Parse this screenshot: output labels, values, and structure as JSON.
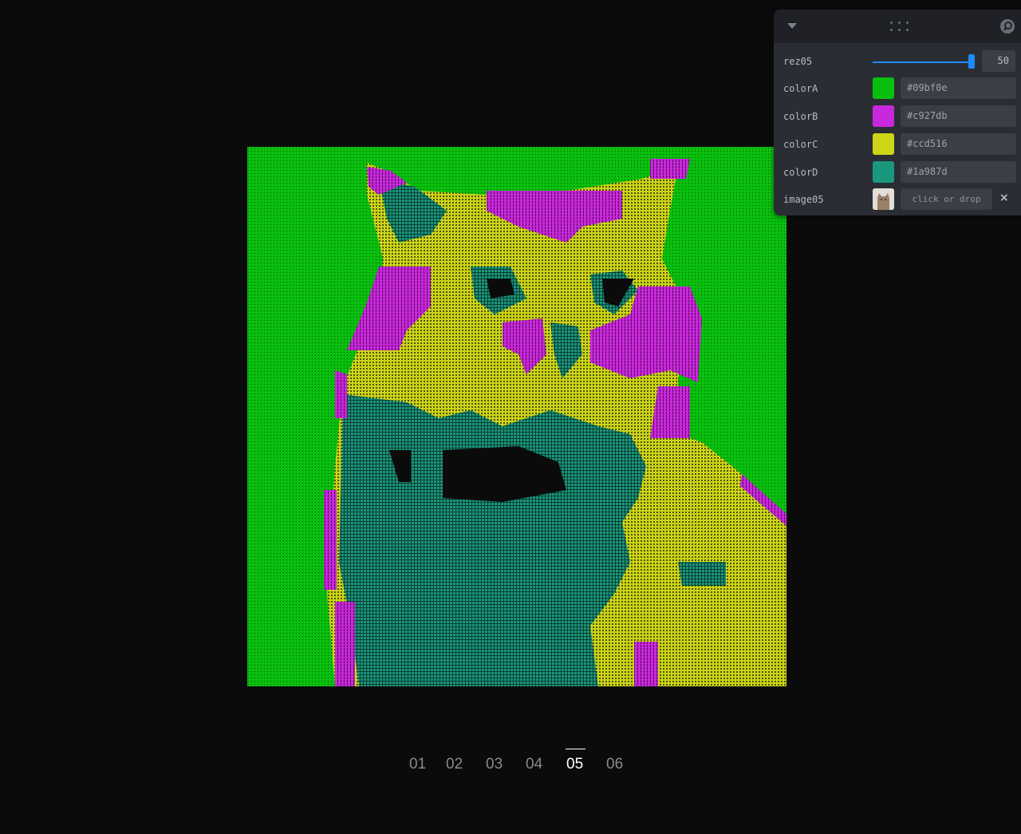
{
  "panel": {
    "controls": [
      {
        "label": "rez05",
        "type": "slider",
        "value": "50",
        "fraction": 1.0
      },
      {
        "label": "colorA",
        "type": "color",
        "value": "#09bf0e"
      },
      {
        "label": "colorB",
        "type": "color",
        "value": "#c927db"
      },
      {
        "label": "colorC",
        "type": "color",
        "value": "#ccd516"
      },
      {
        "label": "colorD",
        "type": "color",
        "value": "#1a987d"
      },
      {
        "label": "image05",
        "type": "image",
        "value": "click or drop"
      }
    ],
    "close_icon": "×"
  },
  "pager": {
    "items": [
      "01",
      "02",
      "03",
      "04",
      "05",
      "06"
    ],
    "active": "05"
  },
  "palette": {
    "colorA": "#09bf0e",
    "colorB": "#c927db",
    "colorC": "#ccd516",
    "colorD": "#1a987d",
    "background": "#0b0b0b"
  }
}
